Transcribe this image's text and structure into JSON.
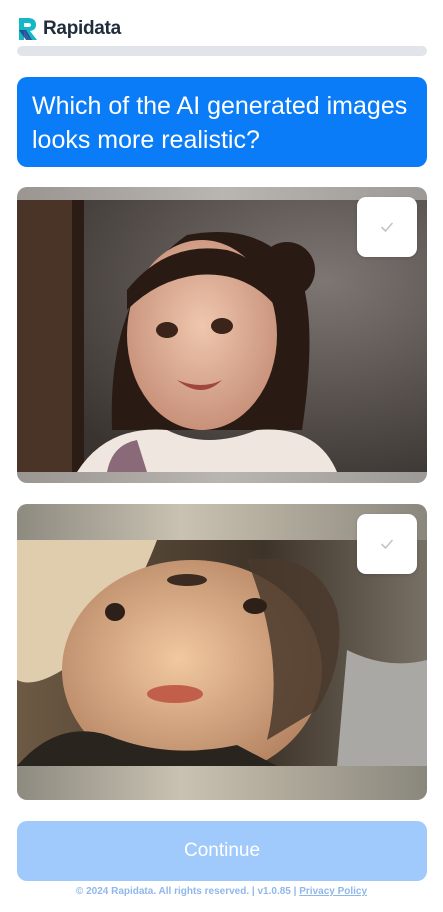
{
  "brand": {
    "name": "Rapidata",
    "logo_icon": "rapidata-logo-icon"
  },
  "progress": {
    "fraction": 0.0
  },
  "question": {
    "text": "Which of the AI generated images looks more realistic?"
  },
  "options": [
    {
      "check_icon": "checkmark-icon",
      "selected": false,
      "image_description": "portrait-of-smiling-girl"
    },
    {
      "check_icon": "checkmark-icon",
      "selected": false,
      "image_description": "distorted-painted-faces"
    }
  ],
  "continue": {
    "label": "Continue",
    "enabled": false
  },
  "footer": {
    "copyright": "© 2024 Rapidata. All rights reserved.",
    "separator": "|",
    "version": "v1.0.85",
    "privacy_label": "Privacy Policy"
  },
  "colors": {
    "accent": "#0b7cf7",
    "button_disabled": "#a0cafb",
    "track": "#e1e5ea"
  }
}
